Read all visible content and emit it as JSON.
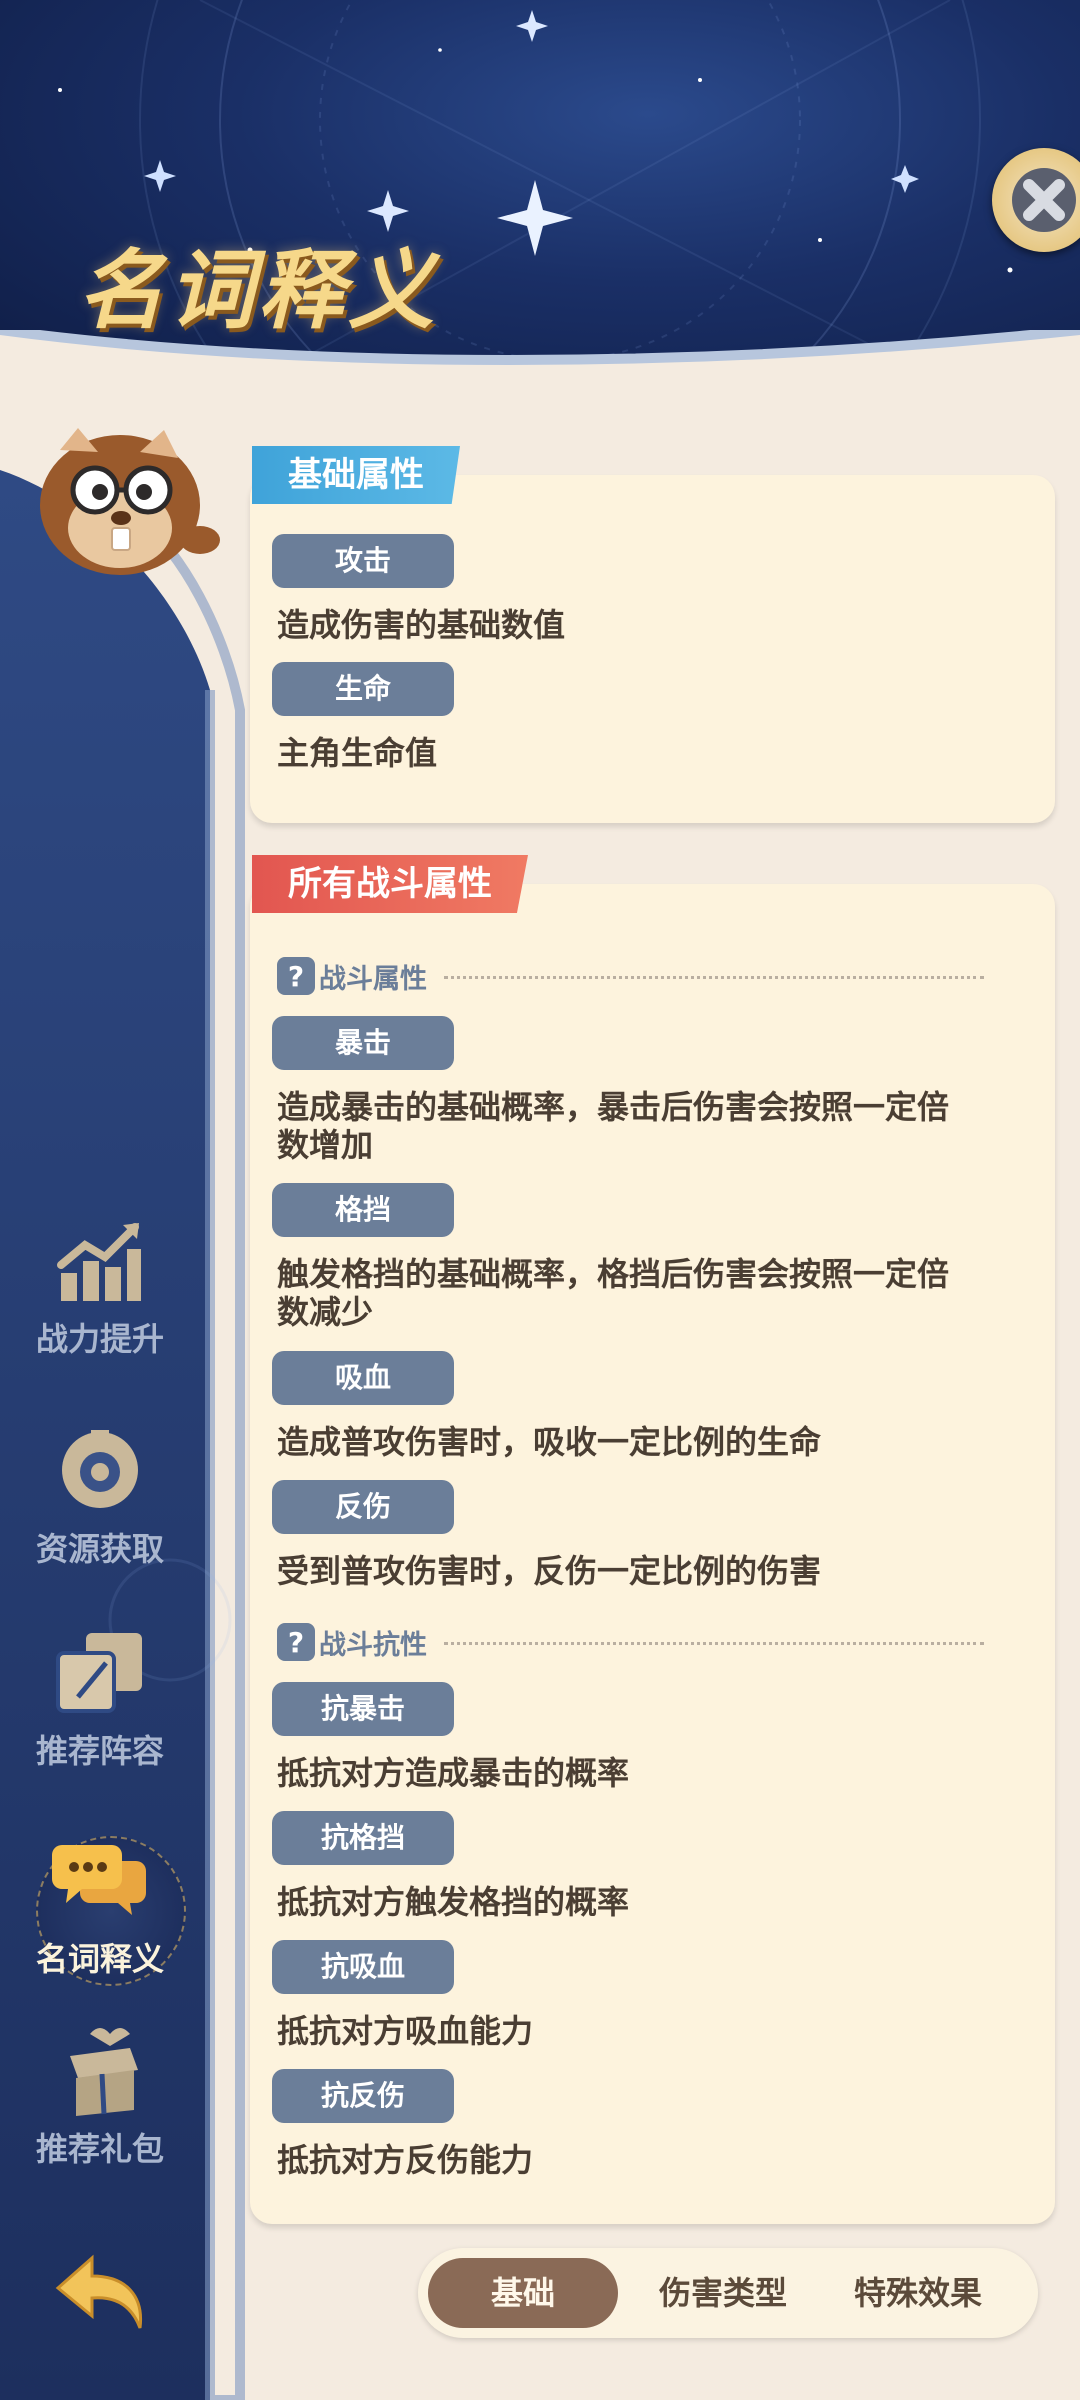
{
  "header": {
    "title": "名词释义"
  },
  "sidebar": {
    "items": [
      {
        "label": "战力提升",
        "icon": "chart-up-icon"
      },
      {
        "label": "资源获取",
        "icon": "resource-icon"
      },
      {
        "label": "推荐阵容",
        "icon": "cards-icon"
      },
      {
        "label": "名词释义",
        "icon": "chat-bubble-icon",
        "active": true
      },
      {
        "label": "推荐礼包",
        "icon": "gift-box-icon"
      }
    ]
  },
  "panels": {
    "basic": {
      "title": "基础属性",
      "terms": [
        {
          "term": "攻击",
          "desc": "造成伤害的基础数值"
        },
        {
          "term": "生命",
          "desc": "主角生命值"
        }
      ]
    },
    "combat": {
      "title": "所有战斗属性",
      "section1": "战斗属性",
      "terms1": [
        {
          "term": "暴击",
          "desc_line1": "造成暴击的基础概率，暴击后伤害会按照一定倍",
          "desc_line2": "数增加"
        },
        {
          "term": "格挡",
          "desc_line1": "触发格挡的基础概率，格挡后伤害会按照一定倍",
          "desc_line2": "数减少"
        },
        {
          "term": "吸血",
          "desc": "造成普攻伤害时，吸收一定比例的生命"
        },
        {
          "term": "反伤",
          "desc": "受到普攻伤害时，反伤一定比例的伤害"
        }
      ],
      "section2": "战斗抗性",
      "terms2": [
        {
          "term": "抗暴击",
          "desc": "抵抗对方造成暴击的概率"
        },
        {
          "term": "抗格挡",
          "desc": "抵抗对方触发格挡的概率"
        },
        {
          "term": "抗吸血",
          "desc": "抵抗对方吸血能力"
        },
        {
          "term": "抗反伤",
          "desc": "抵抗对方反伤能力"
        }
      ]
    }
  },
  "tabs": [
    {
      "label": "基础",
      "active": true
    },
    {
      "label": "伤害类型"
    },
    {
      "label": "特殊效果"
    }
  ],
  "colors": {
    "header_bg": "#1a2f66",
    "title": "#f6d88a",
    "tag_blue": "#3fa3d9",
    "tag_red": "#e25650",
    "term_chip": "#6b7e99",
    "panel_bg": "#fdf3dd",
    "tab_active": "#8a6a56"
  }
}
